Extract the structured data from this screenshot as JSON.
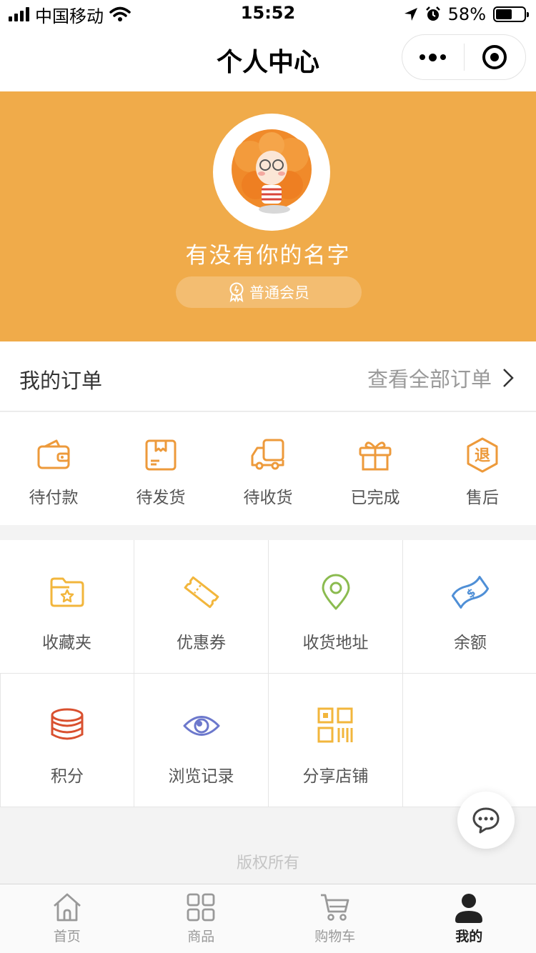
{
  "status_bar": {
    "carrier": "中国移动",
    "time": "15:52",
    "battery": "58%",
    "battery_level": 0.58
  },
  "nav": {
    "title": "个人中心"
  },
  "profile": {
    "username": "有没有你的名字",
    "member_level": "普通会员"
  },
  "orders": {
    "title": "我的订单",
    "view_all": "查看全部订单",
    "items": [
      {
        "label": "待付款",
        "icon": "wallet-icon"
      },
      {
        "label": "待发货",
        "icon": "package-icon"
      },
      {
        "label": "待收货",
        "icon": "truck-icon"
      },
      {
        "label": "已完成",
        "icon": "gift-icon"
      },
      {
        "label": "售后",
        "icon": "refund-icon",
        "glyph": "退"
      }
    ]
  },
  "services": [
    {
      "label": "收藏夹",
      "icon": "favorites-folder-icon"
    },
    {
      "label": "优惠券",
      "icon": "coupon-icon"
    },
    {
      "label": "收货地址",
      "icon": "location-pin-icon"
    },
    {
      "label": "余额",
      "icon": "balance-money-icon"
    },
    {
      "label": "积分",
      "icon": "coins-icon"
    },
    {
      "label": "浏览记录",
      "icon": "eye-icon"
    },
    {
      "label": "分享店铺",
      "icon": "qr-code-icon"
    }
  ],
  "footer": {
    "copyright": "版权所有"
  },
  "tabbar": {
    "items": [
      {
        "label": "首页",
        "icon": "home-icon",
        "active": false
      },
      {
        "label": "商品",
        "icon": "grid-icon",
        "active": false
      },
      {
        "label": "购物车",
        "icon": "cart-icon",
        "active": false
      },
      {
        "label": "我的",
        "icon": "user-icon",
        "active": true
      }
    ]
  },
  "colors": {
    "brand": "#f0ab4a",
    "icon_orange": "#ed9a3b",
    "pin_green": "#8bbb4f",
    "balance_blue": "#4f8fd6",
    "coin_red": "#d9502f",
    "eye_purple": "#6c78cc",
    "qr_yellow": "#f2b63c"
  }
}
